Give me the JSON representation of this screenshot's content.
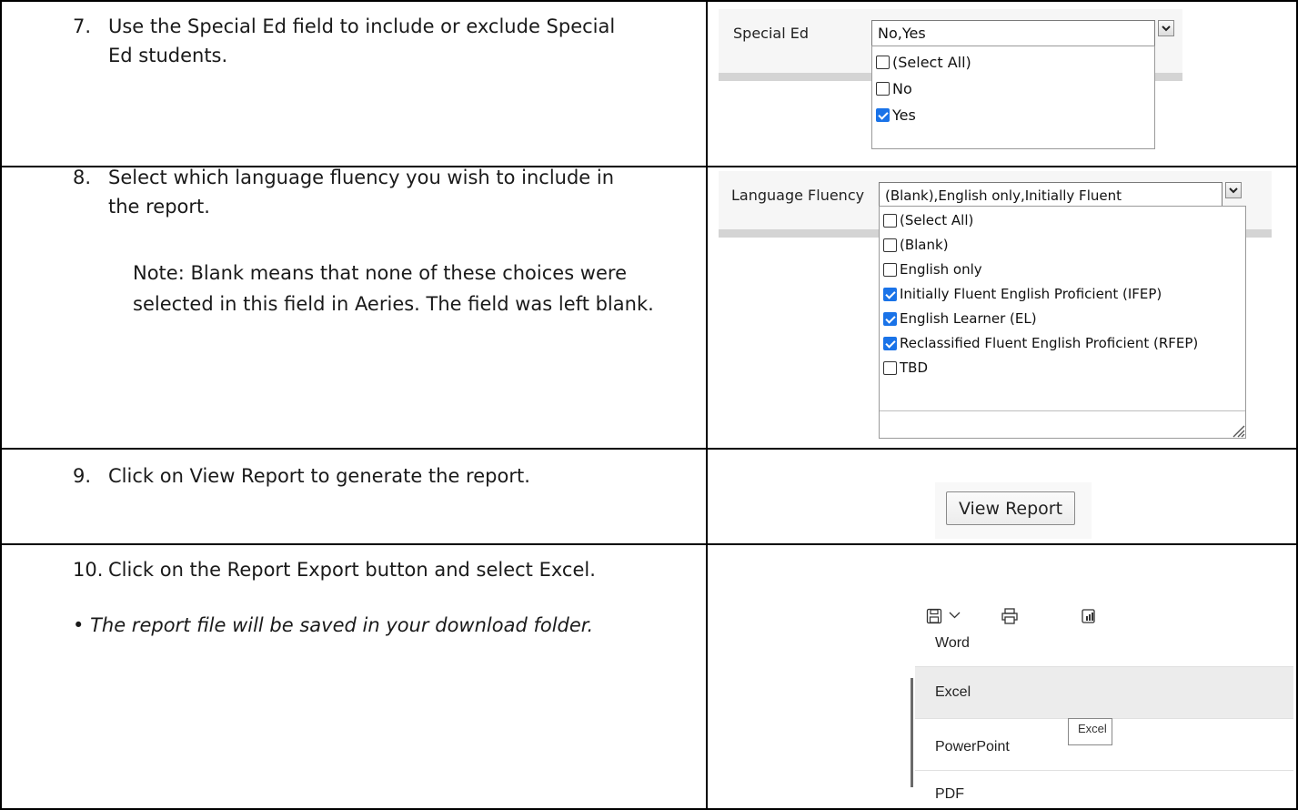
{
  "rows": [
    {
      "number": "7.",
      "text_lines": [
        "Use the Special Ed field to include or exclude Special",
        "Ed students."
      ]
    },
    {
      "number": "8.",
      "text_lines": [
        "Select which language fluency you wish to include in",
        "the report."
      ],
      "note_lines": [
        "Note: Blank means that none of these choices were",
        "selected in this field in Aeries. The field was left blank."
      ]
    },
    {
      "number": "9.",
      "text_lines": [
        "Click on View Report to generate the report."
      ]
    },
    {
      "number": "10.",
      "text_lines": [
        "Click on the Report Export button and select Excel."
      ],
      "bullet": "•",
      "bullet_note": "The report file will be saved in your download folder."
    }
  ],
  "special_ed": {
    "label": "Special Ed",
    "value": "No,Yes",
    "options": [
      {
        "label": "(Select All)",
        "checked": false
      },
      {
        "label": "No",
        "checked": false
      },
      {
        "label": "Yes",
        "checked": true
      }
    ]
  },
  "language_fluency": {
    "label": "Language Fluency",
    "value": "(Blank),English only,Initially Fluent",
    "options": [
      {
        "label": "(Select All)",
        "checked": false
      },
      {
        "label": "(Blank)",
        "checked": false
      },
      {
        "label": "English only",
        "checked": false
      },
      {
        "label": "Initially Fluent English Proficient (IFEP)",
        "checked": true
      },
      {
        "label": "English Learner (EL)",
        "checked": true
      },
      {
        "label": "Reclassified Fluent English Proficient (RFEP)",
        "checked": true
      },
      {
        "label": "TBD",
        "checked": false
      }
    ]
  },
  "view_report": {
    "label": "View Report"
  },
  "export_menu": {
    "items": [
      "Word",
      "Excel",
      "PowerPoint",
      "PDF"
    ],
    "hover_item": "Excel",
    "tooltip": "Excel"
  },
  "colors": {
    "checkbox_checked": "#1a73e8",
    "border": "#000000"
  }
}
